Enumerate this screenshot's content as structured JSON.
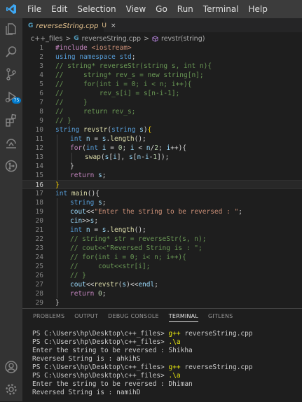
{
  "menu": [
    "File",
    "Edit",
    "Selection",
    "View",
    "Go",
    "Run",
    "Terminal",
    "Help"
  ],
  "activity": {
    "badge": "75"
  },
  "tab": {
    "filename": "reverseString.cpp",
    "modified": "U",
    "close": "×"
  },
  "breadcrumb": {
    "folder": "c++_files",
    "sep": ">",
    "file": "reverseString.cpp",
    "symbol": "revstr(string)"
  },
  "editor": {
    "active_line": 16,
    "lines": [
      {
        "n": "1",
        "indent": 0,
        "t": [
          [
            "pp",
            "#include "
          ],
          [
            "inc",
            "<iostream>"
          ]
        ]
      },
      {
        "n": "2",
        "indent": 0,
        "t": [
          [
            "kw",
            "using "
          ],
          [
            "kw",
            "namespace "
          ],
          [
            "ty",
            "std"
          ],
          [
            "plain",
            ";"
          ]
        ]
      },
      {
        "n": "3",
        "indent": 0,
        "t": [
          [
            "cm",
            "// string* reverseStr(string s, int n){"
          ]
        ]
      },
      {
        "n": "4",
        "indent": 0,
        "t": [
          [
            "cm",
            "//     string* rev_s = new string[n];"
          ]
        ]
      },
      {
        "n": "5",
        "indent": 0,
        "t": [
          [
            "cm",
            "//     for(int i = 0; i < n; i++){"
          ]
        ]
      },
      {
        "n": "6",
        "indent": 0,
        "t": [
          [
            "cm",
            "//         rev_s[i] = s[n-i-1];"
          ]
        ]
      },
      {
        "n": "7",
        "indent": 0,
        "t": [
          [
            "cm",
            "//     }"
          ]
        ]
      },
      {
        "n": "8",
        "indent": 0,
        "t": [
          [
            "cm",
            "//     return rev_s;"
          ]
        ]
      },
      {
        "n": "9",
        "indent": 0,
        "t": [
          [
            "cm",
            "// }"
          ]
        ]
      },
      {
        "n": "10",
        "indent": 0,
        "t": [
          [
            "ty",
            "string "
          ],
          [
            "fn",
            "revstr"
          ],
          [
            "plain",
            "("
          ],
          [
            "ty",
            "string "
          ],
          [
            "var",
            "s"
          ],
          [
            "plain",
            ")"
          ],
          [
            "br",
            "{"
          ]
        ]
      },
      {
        "n": "11",
        "indent": 1,
        "t": [
          [
            "kw",
            "int "
          ],
          [
            "var",
            "n"
          ],
          [
            "plain",
            " = "
          ],
          [
            "var",
            "s"
          ],
          [
            "plain",
            "."
          ],
          [
            "fn",
            "length"
          ],
          [
            "plain",
            "();"
          ]
        ]
      },
      {
        "n": "12",
        "indent": 1,
        "t": [
          [
            "pp",
            "for"
          ],
          [
            "plain",
            "("
          ],
          [
            "kw",
            "int "
          ],
          [
            "var",
            "i"
          ],
          [
            "plain",
            " = "
          ],
          [
            "num",
            "0"
          ],
          [
            "plain",
            "; "
          ],
          [
            "var",
            "i"
          ],
          [
            "plain",
            " < "
          ],
          [
            "var",
            "n"
          ],
          [
            "plain",
            "/"
          ],
          [
            "num",
            "2"
          ],
          [
            "plain",
            "; "
          ],
          [
            "var",
            "i"
          ],
          [
            "plain",
            "++){"
          ]
        ]
      },
      {
        "n": "13",
        "indent": 2,
        "t": [
          [
            "fn",
            "swap"
          ],
          [
            "plain",
            "("
          ],
          [
            "var",
            "s"
          ],
          [
            "plain",
            "["
          ],
          [
            "var",
            "i"
          ],
          [
            "plain",
            "], "
          ],
          [
            "var",
            "s"
          ],
          [
            "plain",
            "["
          ],
          [
            "var",
            "n"
          ],
          [
            "plain",
            "-"
          ],
          [
            "var",
            "i"
          ],
          [
            "plain",
            "-"
          ],
          [
            "num",
            "1"
          ],
          [
            "plain",
            "]);"
          ]
        ]
      },
      {
        "n": "14",
        "indent": 1,
        "t": [
          [
            "plain",
            "}"
          ]
        ]
      },
      {
        "n": "15",
        "indent": 1,
        "t": [
          [
            "pp",
            "return "
          ],
          [
            "var",
            "s"
          ],
          [
            "plain",
            ";"
          ]
        ]
      },
      {
        "n": "16",
        "indent": 0,
        "t": [
          [
            "br",
            "}"
          ]
        ]
      },
      {
        "n": "17",
        "indent": 0,
        "t": [
          [
            "kw",
            "int "
          ],
          [
            "fn",
            "main"
          ],
          [
            "plain",
            "(){"
          ]
        ]
      },
      {
        "n": "18",
        "indent": 1,
        "t": [
          [
            "ty",
            "string "
          ],
          [
            "var",
            "s"
          ],
          [
            "plain",
            ";"
          ]
        ]
      },
      {
        "n": "19",
        "indent": 1,
        "t": [
          [
            "var",
            "cout"
          ],
          [
            "plain",
            "<<"
          ],
          [
            "str",
            "\"Enter the string to be reversed : \""
          ],
          [
            "plain",
            ";"
          ]
        ]
      },
      {
        "n": "20",
        "indent": 1,
        "t": [
          [
            "var",
            "cin"
          ],
          [
            "plain",
            ">>"
          ],
          [
            "var",
            "s"
          ],
          [
            "plain",
            ";"
          ]
        ]
      },
      {
        "n": "21",
        "indent": 1,
        "t": [
          [
            "kw",
            "int "
          ],
          [
            "var",
            "n"
          ],
          [
            "plain",
            " = "
          ],
          [
            "var",
            "s"
          ],
          [
            "plain",
            "."
          ],
          [
            "fn",
            "length"
          ],
          [
            "plain",
            "();"
          ]
        ]
      },
      {
        "n": "22",
        "indent": 1,
        "t": [
          [
            "cm",
            "// string* str = reverseStr(s, n);"
          ]
        ]
      },
      {
        "n": "23",
        "indent": 1,
        "t": [
          [
            "cm",
            "// cout<<\"Reversed String is : \";"
          ]
        ]
      },
      {
        "n": "24",
        "indent": 1,
        "t": [
          [
            "cm",
            "// for(int i = 0; i< n; i++){"
          ]
        ]
      },
      {
        "n": "25",
        "indent": 1,
        "t": [
          [
            "cm",
            "//     cout<<str[i];"
          ]
        ]
      },
      {
        "n": "26",
        "indent": 1,
        "t": [
          [
            "cm",
            "// }"
          ]
        ]
      },
      {
        "n": "27",
        "indent": 1,
        "t": [
          [
            "var",
            "cout"
          ],
          [
            "plain",
            "<<"
          ],
          [
            "fn",
            "revstr"
          ],
          [
            "plain",
            "("
          ],
          [
            "var",
            "s"
          ],
          [
            "plain",
            ")<<"
          ],
          [
            "var",
            "endl"
          ],
          [
            "plain",
            ";"
          ]
        ]
      },
      {
        "n": "28",
        "indent": 1,
        "t": [
          [
            "pp",
            "return "
          ],
          [
            "num",
            "0"
          ],
          [
            "plain",
            ";"
          ]
        ]
      },
      {
        "n": "29",
        "indent": 0,
        "t": [
          [
            "plain",
            "}"
          ]
        ]
      }
    ]
  },
  "panel": {
    "tabs": [
      "PROBLEMS",
      "OUTPUT",
      "DEBUG CONSOLE",
      "TERMINAL",
      "GITLENS"
    ],
    "active_tab": "TERMINAL"
  },
  "terminal": [
    {
      "prompt": "PS C:\\Users\\hp\\Desktop\\c++_files> ",
      "cmd": "g++",
      "rest": " reverseString.cpp"
    },
    {
      "prompt": "PS C:\\Users\\hp\\Desktop\\c++_files> ",
      "cmd": ".\\a",
      "rest": ""
    },
    {
      "prompt": "",
      "cmd": "",
      "rest": "Enter the string to be reversed : Shikha"
    },
    {
      "prompt": "",
      "cmd": "",
      "rest": "Reversed String is : ahkihS"
    },
    {
      "prompt": "PS C:\\Users\\hp\\Desktop\\c++_files> ",
      "cmd": "g++",
      "rest": " reverseString.cpp"
    },
    {
      "prompt": "PS C:\\Users\\hp\\Desktop\\c++_files> ",
      "cmd": ".\\a",
      "rest": ""
    },
    {
      "prompt": "",
      "cmd": "",
      "rest": "Enter the string to be reversed : Dhiman"
    },
    {
      "prompt": "",
      "cmd": "",
      "rest": "Reversed String is : namihD"
    }
  ],
  "colors": {
    "accent": "#007acc",
    "modified": "#e2c08d",
    "titlebar": "#3c3c3c",
    "activitybar": "#333333"
  }
}
